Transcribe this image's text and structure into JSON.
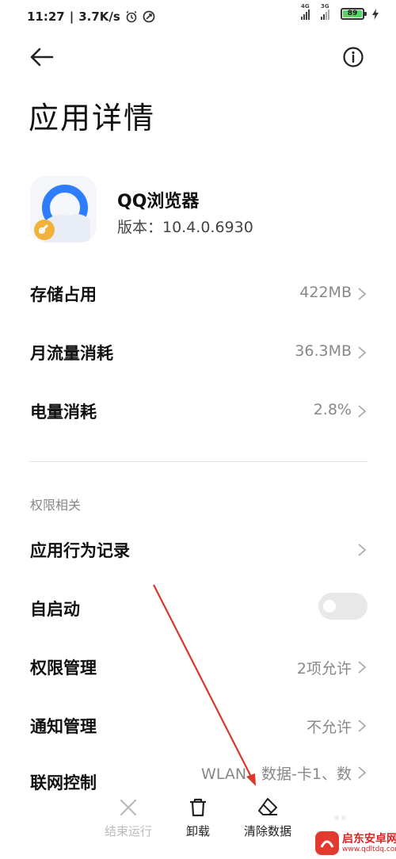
{
  "status": {
    "time": "11:27",
    "speed": "3.7K/s",
    "signal1_label": "4G",
    "signal2_label": "3G",
    "battery": "89"
  },
  "header": {
    "title": "应用详情"
  },
  "app": {
    "name": "QQ浏览器",
    "version": "版本：10.4.0.6930"
  },
  "rows": {
    "storage": {
      "label": "存储占用",
      "value": "422MB"
    },
    "traffic": {
      "label": "月流量消耗",
      "value": "36.3MB"
    },
    "battery": {
      "label": "电量消耗",
      "value": "2.8%"
    }
  },
  "permissions": {
    "section_label": "权限相关",
    "behavior": {
      "label": "应用行为记录"
    },
    "autostart": {
      "label": "自启动",
      "enabled": false
    },
    "permission_manage": {
      "label": "权限管理",
      "value": "2项允许"
    },
    "notification": {
      "label": "通知管理",
      "value": "不允许"
    },
    "network": {
      "label": "联网控制",
      "value": "WLAN、数据-卡1、数"
    }
  },
  "bottom_bar": {
    "stop": "结束运行",
    "uninstall": "卸载",
    "clear": "清除数据"
  },
  "watermark": {
    "name": "启东安卓网",
    "url": "www.qdltdq.com"
  },
  "colors": {
    "accent_arrow": "#d9362c",
    "toggle_off": "#e8e8e8",
    "app_icon_blue": "#2f7dff",
    "app_icon_badge": "#f2b23a"
  }
}
